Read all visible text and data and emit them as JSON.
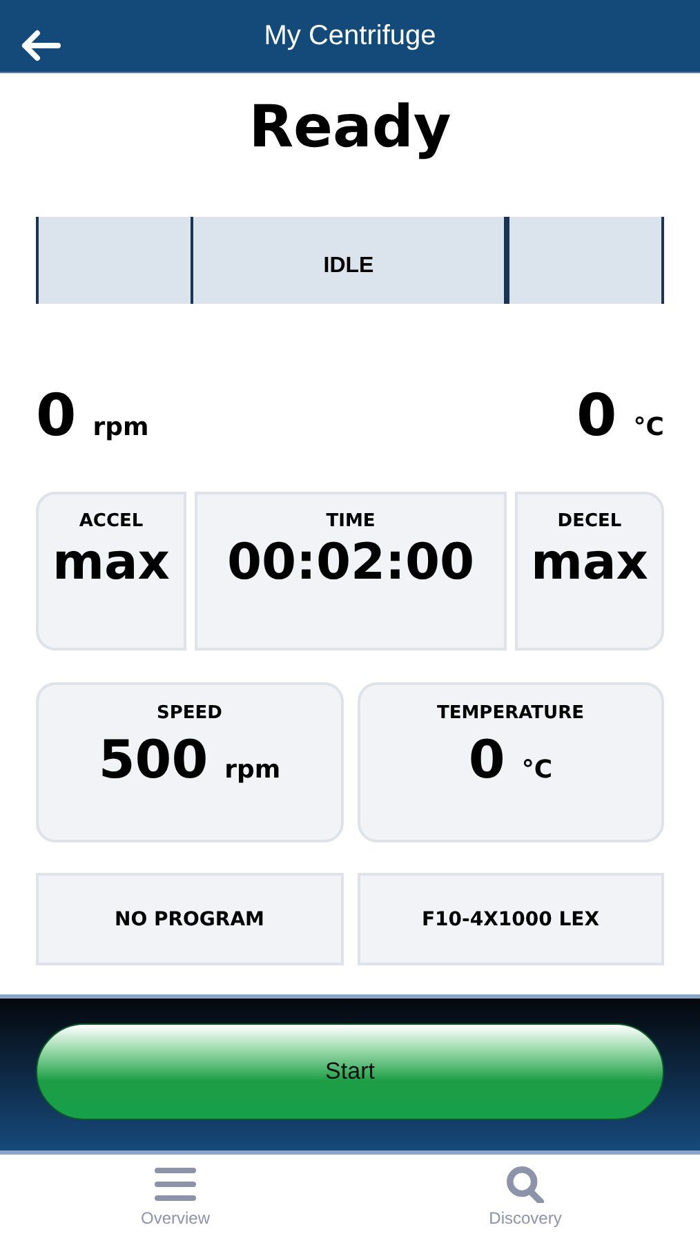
{
  "header": {
    "title": "My Centrifuge"
  },
  "status": "Ready",
  "state_bar": {
    "label": "IDLE"
  },
  "readings": [
    {
      "value": "0",
      "unit": "rpm"
    },
    {
      "value": "0",
      "unit": "°C"
    }
  ],
  "settings_top": [
    {
      "label": "ACCEL",
      "value": "max"
    },
    {
      "label": "TIME",
      "value": "00:02:00"
    },
    {
      "label": "DECEL",
      "value": "max"
    }
  ],
  "settings_mid": [
    {
      "label": "SPEED",
      "value": "500",
      "unit": "rpm"
    },
    {
      "label": "TEMPERATURE",
      "value": "0",
      "unit": "°C"
    }
  ],
  "selectors": [
    "NO PROGRAM",
    "F10-4X1000 LEX"
  ],
  "start_button": "Start",
  "tabs": [
    {
      "label": "Overview",
      "kind": "menu"
    },
    {
      "label": "Discovery",
      "kind": "search"
    }
  ]
}
